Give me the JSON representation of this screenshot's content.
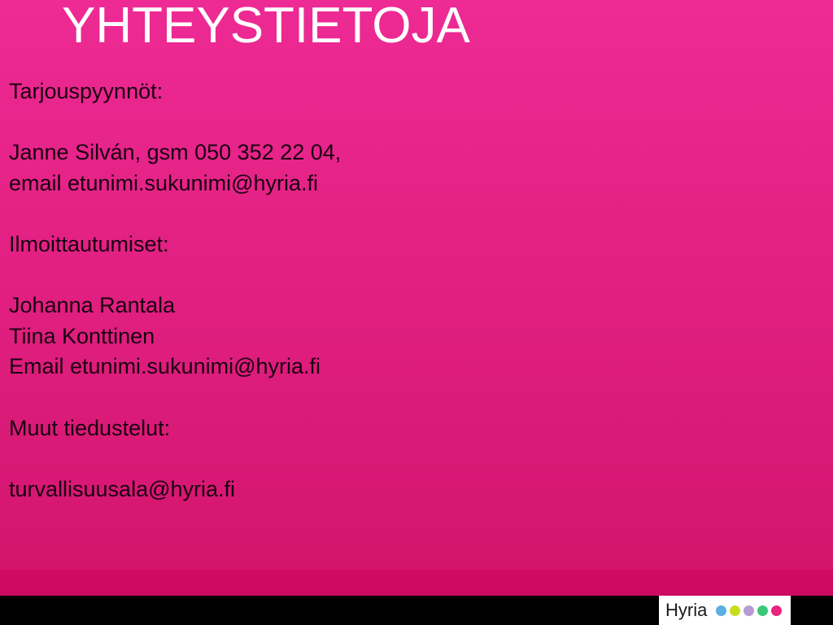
{
  "slide": {
    "title": "YHTEYSTIETOJA",
    "lines": [
      "Tarjouspyynnöt:",
      "",
      "Janne Silván, gsm 050 352 22 04,",
      "email etunimi.sukunimi@hyria.fi",
      "",
      "Ilmoittautumiset:",
      "",
      "Johanna Rantala",
      "Tiina Konttinen",
      "Email etunimi.sukunimi@hyria.fi",
      "",
      "Muut tiedustelut:",
      "",
      "turvallisuusala@hyria.fi"
    ]
  },
  "footer": {
    "logo_text": "Hyria",
    "logo_dots": [
      {
        "name": "blue-dot",
        "color": "#5aaee0"
      },
      {
        "name": "lime-dot",
        "color": "#c8dc1e"
      },
      {
        "name": "lilac-dot",
        "color": "#b79ad6"
      },
      {
        "name": "green-dot",
        "color": "#3cc87a"
      },
      {
        "name": "pink-dot",
        "color": "#e8247f"
      }
    ]
  },
  "colors": {
    "background_top": "#ee2a94",
    "background_bottom": "#d1136a",
    "title": "#ffffff",
    "text": "#1a0010",
    "footer_bar": "#000000"
  }
}
